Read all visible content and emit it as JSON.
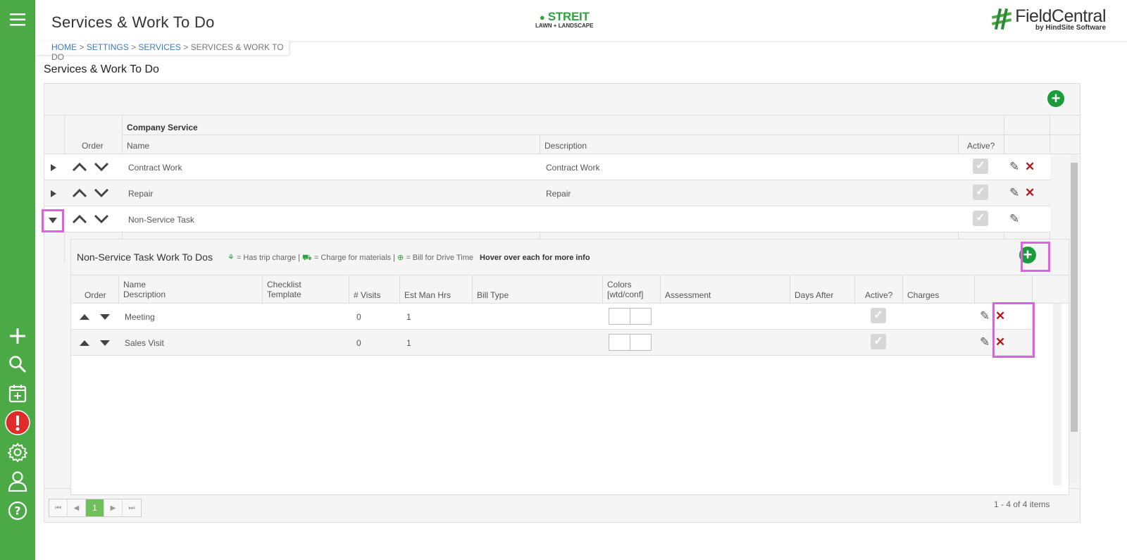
{
  "header": {
    "title": "Services & Work To Do",
    "center_logo_line1": "STREIT",
    "center_logo_line2": "LAWN + LANDSCAPE",
    "brand_name": "FieldCentral",
    "brand_by": "by HindSite Software"
  },
  "breadcrumb": {
    "home": "HOME",
    "settings": "SETTINGS",
    "services": "SERVICES",
    "current": "SERVICES & WORK TO DO",
    "sep": ">"
  },
  "section_title": "Services & Work To Do",
  "grid": {
    "group_header": "Company Service",
    "columns": {
      "order": "Order",
      "name": "Name",
      "description": "Description",
      "active": "Active?"
    },
    "rows": [
      {
        "name": "Contract Work",
        "description": "Contract Work",
        "active": true,
        "deletable": true
      },
      {
        "name": "Repair",
        "description": "Repair",
        "active": true,
        "deletable": true
      },
      {
        "name": "Non-Service Task",
        "description": "",
        "active": true,
        "deletable": false
      }
    ]
  },
  "subgrid": {
    "title": "Non-Service Task Work To Dos",
    "legend_trip": "= Has trip charge",
    "legend_materials": "= Charge for materials",
    "legend_drive": "= Bill for Drive Time",
    "legend_sep": "|",
    "hover_hint": "Hover over each for more info",
    "columns": {
      "order": "Order",
      "name": "Name",
      "description": "Description",
      "checklist": "Checklist",
      "template": "Template",
      "visits": "# Visits",
      "est_hrs": "Est Man Hrs",
      "bill_type": "Bill Type",
      "colors": "Colors",
      "colors_sub": "[wtd/conf]",
      "assessment": "Assessment",
      "days_after": "Days After",
      "active": "Active?",
      "charges": "Charges"
    },
    "rows": [
      {
        "name": "Meeting",
        "visits": "0",
        "est_hrs": "1"
      },
      {
        "name": "Sales Visit",
        "visits": "0",
        "est_hrs": "1"
      }
    ]
  },
  "pager": {
    "first": "⏮",
    "prev": "◀",
    "page": "1",
    "next": "▶",
    "last": "⏭",
    "summary": "1 - 4 of 4 items"
  },
  "colors": {
    "sidebar": "#4caa46",
    "accent_green": "#1a9c3a",
    "delete_red": "#b4161b",
    "highlight": "#e35ee6"
  }
}
